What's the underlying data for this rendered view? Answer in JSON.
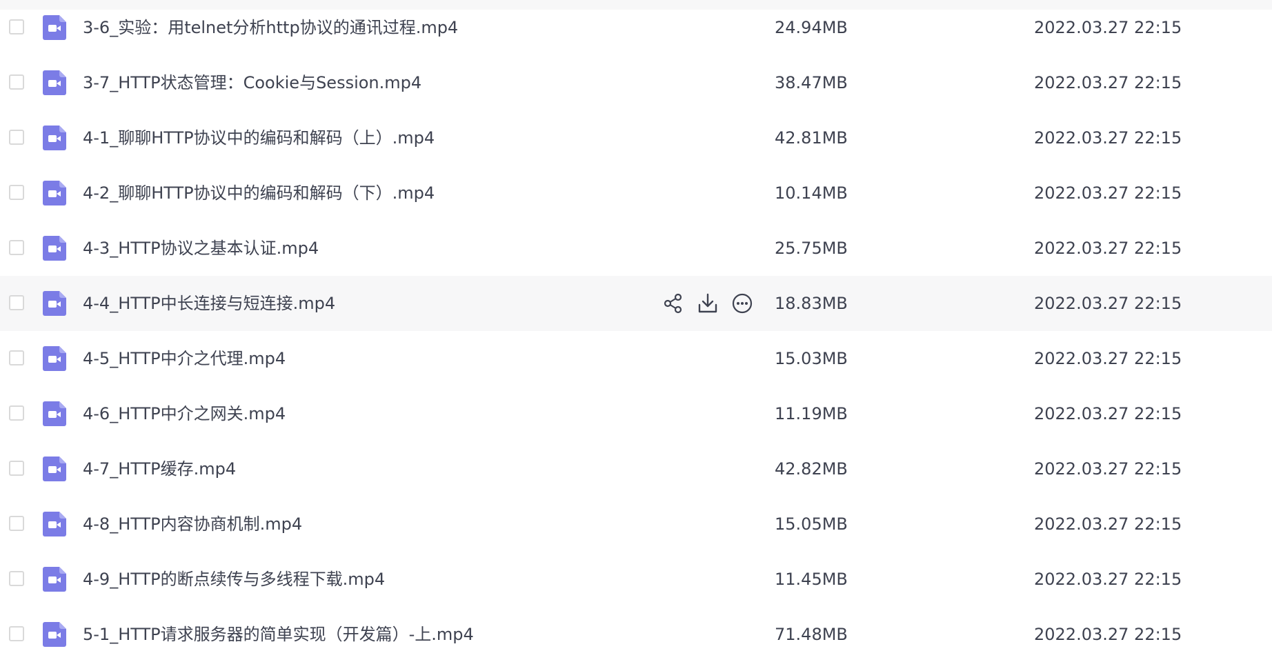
{
  "colors": {
    "text": "#3e4250",
    "video_icon": "#7b7ce6",
    "hover_row": "#f7f7f8",
    "checkbox_border": "#d9d9d9"
  },
  "icons": {
    "file_type": "video-file-icon",
    "actions": [
      "share-icon",
      "download-icon",
      "more-icon"
    ]
  },
  "hovered_row_index": 5,
  "files": [
    {
      "name": "3-6_实验：用telnet分析http协议的通讯过程.mp4",
      "size": "24.94MB",
      "date": "2022.03.27 22:15"
    },
    {
      "name": "3-7_HTTP状态管理：Cookie与Session.mp4",
      "size": "38.47MB",
      "date": "2022.03.27 22:15"
    },
    {
      "name": "4-1_聊聊HTTP协议中的编码和解码（上）.mp4",
      "size": "42.81MB",
      "date": "2022.03.27 22:15"
    },
    {
      "name": "4-2_聊聊HTTP协议中的编码和解码（下）.mp4",
      "size": "10.14MB",
      "date": "2022.03.27 22:15"
    },
    {
      "name": "4-3_HTTP协议之基本认证.mp4",
      "size": "25.75MB",
      "date": "2022.03.27 22:15"
    },
    {
      "name": "4-4_HTTP中长连接与短连接.mp4",
      "size": "18.83MB",
      "date": "2022.03.27 22:15"
    },
    {
      "name": "4-5_HTTP中介之代理.mp4",
      "size": "15.03MB",
      "date": "2022.03.27 22:15"
    },
    {
      "name": "4-6_HTTP中介之网关.mp4",
      "size": "11.19MB",
      "date": "2022.03.27 22:15"
    },
    {
      "name": "4-7_HTTP缓存.mp4",
      "size": "42.82MB",
      "date": "2022.03.27 22:15"
    },
    {
      "name": "4-8_HTTP内容协商机制.mp4",
      "size": "15.05MB",
      "date": "2022.03.27 22:15"
    },
    {
      "name": "4-9_HTTP的断点续传与多线程下载.mp4",
      "size": "11.45MB",
      "date": "2022.03.27 22:15"
    },
    {
      "name": "5-1_HTTP请求服务器的简单实现（开发篇）-上.mp4",
      "size": "71.48MB",
      "date": "2022.03.27 22:15"
    }
  ]
}
